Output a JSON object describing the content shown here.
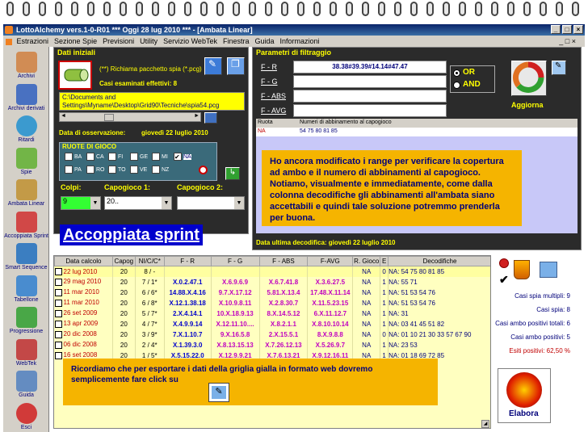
{
  "titlebar": {
    "title": "LottoAlchemy vers.1-0-R01  ***  Oggi 28 lug 2010  ***  - [Ambata Linear]"
  },
  "menu": [
    "Estrazioni",
    "Sezione Spie",
    "Previsioni",
    "Utility",
    "Servizio WebTek",
    "Finestra",
    "Guida",
    "Informazioni"
  ],
  "sidebar": [
    {
      "label": "Archivi",
      "icon": "pencil-icon"
    },
    {
      "label": "Archivi derivati",
      "icon": "monitor-icon"
    },
    {
      "label": "Ritardi",
      "icon": "clock-icon"
    },
    {
      "label": "Spie",
      "icon": "spy-icon"
    },
    {
      "label": "Ambata Linear",
      "icon": "letter-a-icon"
    },
    {
      "label": "Accoppiata Sprint",
      "icon": "recycle-icon"
    },
    {
      "label": "Smart Sequence",
      "icon": "shield-icon"
    },
    {
      "label": "Tabellone",
      "icon": "table-icon"
    },
    {
      "label": "Progressione",
      "icon": "dollar-icon"
    },
    {
      "label": "WebTek",
      "icon": "web-a-icon"
    },
    {
      "label": "Guida",
      "icon": "guide-icon"
    },
    {
      "label": "Esci",
      "icon": "exit-icon"
    }
  ],
  "dati": {
    "title": "Dati iniziali",
    "richiama": "(**) Richiama pacchetto spia (*.pcg)",
    "casi": "Casi esaminati effettivi: 8",
    "path": "C:\\Documents and Settings\\Myname\\Desktop\\Grid90\\Tecniche\\spia54.pcg",
    "data_oss_label": "Data di osservazione:",
    "data_oss_value": "giovedì 22 luglio 2010",
    "ruote_title": "RUOTE DI GIOCO",
    "ruote": [
      "BA",
      "CA",
      "FI",
      "GE",
      "MI",
      "NA",
      "PA",
      "RO",
      "TO",
      "VE",
      "NZ"
    ],
    "colpi_label": "Colpi:",
    "colpi_value": "9",
    "capogioco1_label": "Capogioco 1:",
    "capogioco1_value": "20..",
    "capogioco2_label": "Capogioco 2:",
    "capogioco2_value": ""
  },
  "filtri": {
    "title": "Parametri di filtraggio",
    "labels": [
      "F - R",
      "F - G",
      "F - ABS",
      "F - AVG"
    ],
    "fr_value": "38.38#39.39#14.14#47.47",
    "or": "OR",
    "and": "AND",
    "aggiorna": "Aggiorna",
    "col_ruota": "Ruota",
    "col_numeri": "Numeri di abbinamento al capogioco",
    "row_ruota": "NA",
    "row_numeri": "54 75 80 81 85",
    "ultima": "Data ultima decodifica: giovedì 22 luglio 2010"
  },
  "note1": "Ho ancora modificato i range per verificare la copertura ad ambo e il numero di abbinamenti al capogioco. Notiamo, visualmente e immediatamente, come dalla colonna decodifiche gli abbinamenti all'ambata siano accettabili e quindi tale soluzione potremmo prenderla per buona.",
  "sprint_title": "Accoppiata sprint",
  "grid": {
    "headers": [
      "Data calcolo",
      "Capog",
      "NI/C/C*",
      "F - R",
      "F - G",
      "F - ABS",
      "F-AVG",
      "R. Gioco",
      "E",
      "Decodifiche"
    ],
    "rows": [
      [
        "22 lug 2010",
        "20",
        "8 / -",
        "",
        "",
        "",
        "",
        "NA",
        "0",
        "NA: 54 75 80 81 85"
      ],
      [
        "29 mag 2010",
        "20",
        "7 / 1*",
        "X.0.2.47.1",
        "X.6.9.6.9",
        "X.6.7.41.8",
        "X.3.6.27.5",
        "NA",
        "1",
        "NA: 55 71"
      ],
      [
        "11 mar 2010",
        "20",
        "6 / 6*",
        "14.88.X.4.16",
        "9.7.X.17.12",
        "5.81.X.13.4",
        "17.48.X.11.14",
        "NA",
        "1",
        "NA: 51 53 54 76"
      ],
      [
        "11 mar 2010",
        "20",
        "6 / 8*",
        "X.12.1.38.18",
        "X.10.9.8.11",
        "X.2.8.30.7",
        "X.11.5.23.15",
        "NA",
        "1",
        "NA: 51 53 54 76"
      ],
      [
        "26 set 2009",
        "20",
        "5 / 7*",
        "2.X.4.14.1",
        "10.X.18.9.13",
        "8.X.14.5.12",
        "6.X.11.12.7",
        "NA",
        "1",
        "NA: 31"
      ],
      [
        "13 apr 2009",
        "20",
        "4 / 7*",
        "X.4.9.9.14",
        "X.12.11.10....",
        "X.8.2.1.1",
        "X.8.10.10.14",
        "NA",
        "1",
        "NA: 03 41 45 51 82"
      ],
      [
        "20 dic 2008",
        "20",
        "3 / 9*",
        "7.X.1.10.7",
        "9.X.16.5.8",
        "2.X.15.5.1",
        "8.X.9.8.8",
        "NA",
        "0",
        "NA: 01 10 21 30 33 57 67 90"
      ],
      [
        "06 dic 2008",
        "20",
        "2 / 4*",
        "X.1.39.3.0",
        "X.8.13.15.13",
        "X.7.26.12.13",
        "X.5.26.9.7",
        "NA",
        "1",
        "NA: 23 53"
      ],
      [
        "16 set 2008",
        "20",
        "1 / 5*",
        "X.5.15.22.0",
        "X.12.9.9.21",
        "X.7.6.13.21",
        "X.9.12.16.11",
        "NA",
        "1",
        "NA: 01 18 69 72 85"
      ]
    ]
  },
  "note2": "Ricordiamo che per esportare i dati della griglia gialla in formato web dovremo semplicemente fare click su",
  "stats": [
    "Casi spia multipli: 9",
    "Casi spia: 8",
    "Casi ambo positivi totali: 6",
    "Casi ambo positivi: 5",
    "Esiti positivi: 62,50 %"
  ],
  "elabora": "Elabora",
  "colors": {
    "panel": "#2b2b2b",
    "yellow": "#ffff00",
    "note": "#f5b400",
    "grid_bg": "#ffffc0",
    "title_blue": "#0000cc"
  }
}
